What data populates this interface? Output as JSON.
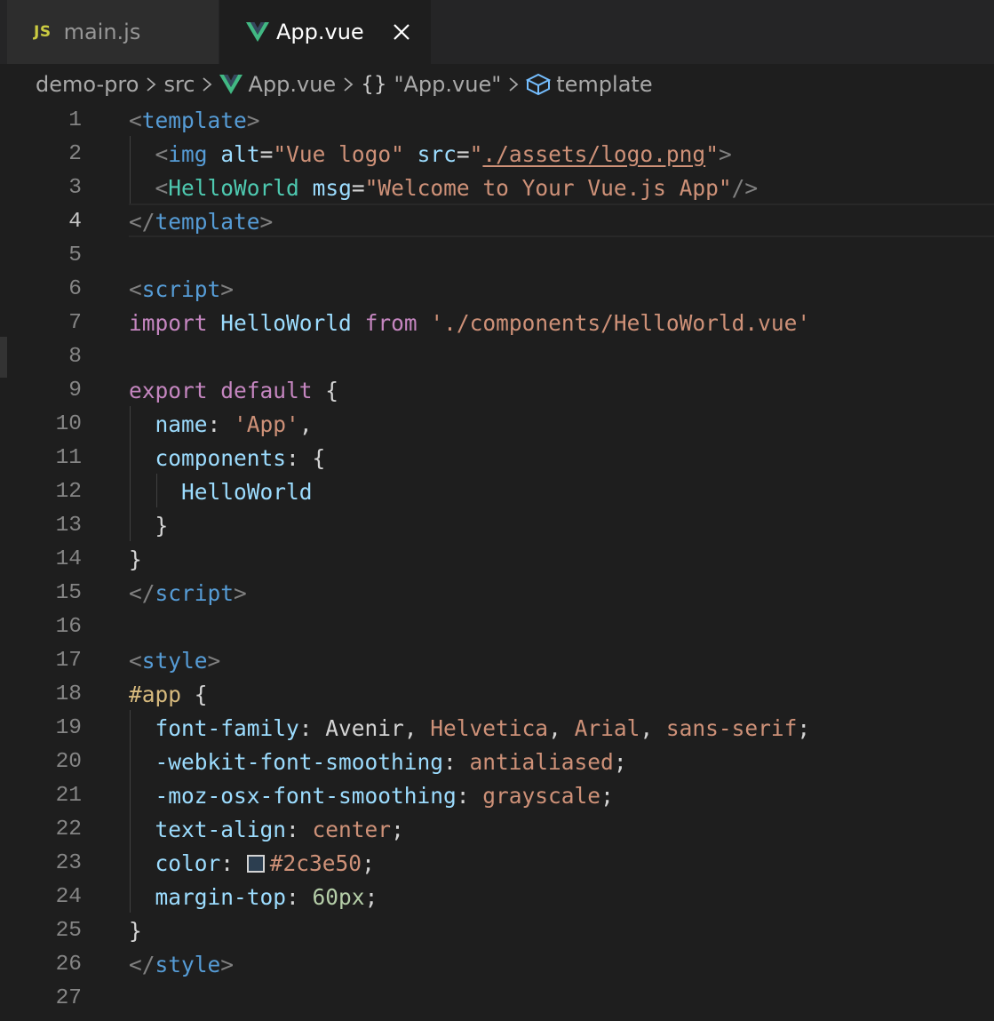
{
  "tabs": [
    {
      "icon": "JS",
      "label": "main.js",
      "active": false
    },
    {
      "icon": "vue-logo",
      "label": "App.vue",
      "active": true
    }
  ],
  "breadcrumb": {
    "items": [
      "demo-pro",
      "src",
      "App.vue",
      "\"App.vue\"",
      "template"
    ]
  },
  "colors": {
    "swatch": "#2c3e50",
    "vue_green": "#41b883"
  },
  "editor": {
    "current_line": 4,
    "lines": [
      [
        [
          "t-brk",
          "<"
        ],
        [
          "t-tag",
          "template"
        ],
        [
          "t-brk",
          ">"
        ]
      ],
      [
        [
          "t-txt",
          "  "
        ],
        [
          "t-brk",
          "<"
        ],
        [
          "t-tag",
          "img"
        ],
        [
          "t-txt",
          " "
        ],
        [
          "t-attr",
          "alt"
        ],
        [
          "t-txt",
          "="
        ],
        [
          "t-str",
          "\"Vue logo\""
        ],
        [
          "t-txt",
          " "
        ],
        [
          "t-attr",
          "src"
        ],
        [
          "t-txt",
          "="
        ],
        [
          "t-str",
          "\""
        ],
        [
          "t-link",
          "./assets/logo.png"
        ],
        [
          "t-str",
          "\""
        ],
        [
          "t-brk",
          ">"
        ]
      ],
      [
        [
          "t-txt",
          "  "
        ],
        [
          "t-brk",
          "<"
        ],
        [
          "t-comp",
          "HelloWorld"
        ],
        [
          "t-txt",
          " "
        ],
        [
          "t-attr",
          "msg"
        ],
        [
          "t-txt",
          "="
        ],
        [
          "t-str",
          "\"Welcome to Your Vue.js App\""
        ],
        [
          "t-brk",
          "/>"
        ]
      ],
      [
        [
          "t-brk",
          "</"
        ],
        [
          "t-tag",
          "template"
        ],
        [
          "t-brk",
          ">"
        ]
      ],
      [],
      [
        [
          "t-brk",
          "<"
        ],
        [
          "t-tag",
          "script"
        ],
        [
          "t-brk",
          ">"
        ]
      ],
      [
        [
          "t-kw",
          "import"
        ],
        [
          "t-txt",
          " "
        ],
        [
          "t-var",
          "HelloWorld"
        ],
        [
          "t-txt",
          " "
        ],
        [
          "t-kw",
          "from"
        ],
        [
          "t-txt",
          " "
        ],
        [
          "t-str",
          "'./components/HelloWorld.vue'"
        ]
      ],
      [],
      [
        [
          "t-kw",
          "export"
        ],
        [
          "t-txt",
          " "
        ],
        [
          "t-kw",
          "default"
        ],
        [
          "t-txt",
          " {"
        ]
      ],
      [
        [
          "t-txt",
          "  "
        ],
        [
          "t-var",
          "name"
        ],
        [
          "t-txt",
          ": "
        ],
        [
          "t-str",
          "'App'"
        ],
        [
          "t-txt",
          ","
        ]
      ],
      [
        [
          "t-txt",
          "  "
        ],
        [
          "t-var",
          "components"
        ],
        [
          "t-txt",
          ": {"
        ]
      ],
      [
        [
          "t-txt",
          "    "
        ],
        [
          "t-var",
          "HelloWorld"
        ]
      ],
      [
        [
          "t-txt",
          "  }"
        ]
      ],
      [
        [
          "t-txt",
          "}"
        ]
      ],
      [
        [
          "t-brk",
          "</"
        ],
        [
          "t-tag",
          "script"
        ],
        [
          "t-brk",
          ">"
        ]
      ],
      [],
      [
        [
          "t-brk",
          "<"
        ],
        [
          "t-tag",
          "style"
        ],
        [
          "t-brk",
          ">"
        ]
      ],
      [
        [
          "t-sel",
          "#app"
        ],
        [
          "t-txt",
          " {"
        ]
      ],
      [
        [
          "t-txt",
          "  "
        ],
        [
          "t-attr",
          "font-family"
        ],
        [
          "t-txt",
          ": Avenir, "
        ],
        [
          "t-str",
          "Helvetica"
        ],
        [
          "t-txt",
          ", "
        ],
        [
          "t-str",
          "Arial"
        ],
        [
          "t-txt",
          ", "
        ],
        [
          "t-str",
          "sans-serif"
        ],
        [
          "t-txt",
          ";"
        ]
      ],
      [
        [
          "t-txt",
          "  "
        ],
        [
          "t-attr",
          "-webkit-font-smoothing"
        ],
        [
          "t-txt",
          ": "
        ],
        [
          "t-str",
          "antialiased"
        ],
        [
          "t-txt",
          ";"
        ]
      ],
      [
        [
          "t-txt",
          "  "
        ],
        [
          "t-attr",
          "-moz-osx-font-smoothing"
        ],
        [
          "t-txt",
          ": "
        ],
        [
          "t-str",
          "grayscale"
        ],
        [
          "t-txt",
          ";"
        ]
      ],
      [
        [
          "t-txt",
          "  "
        ],
        [
          "t-attr",
          "text-align"
        ],
        [
          "t-txt",
          ": "
        ],
        [
          "t-str",
          "center"
        ],
        [
          "t-txt",
          ";"
        ]
      ],
      [
        [
          "t-txt",
          "  "
        ],
        [
          "t-attr",
          "color"
        ],
        [
          "t-txt",
          ": "
        ],
        [
          "swatch",
          ""
        ],
        [
          "t-str",
          "#2c3e50"
        ],
        [
          "t-txt",
          ";"
        ]
      ],
      [
        [
          "t-txt",
          "  "
        ],
        [
          "t-attr",
          "margin-top"
        ],
        [
          "t-txt",
          ": "
        ],
        [
          "t-num",
          "60px"
        ],
        [
          "t-txt",
          ";"
        ]
      ],
      [
        [
          "t-txt",
          "}"
        ]
      ],
      [
        [
          "t-brk",
          "</"
        ],
        [
          "t-tag",
          "style"
        ],
        [
          "t-brk",
          ">"
        ]
      ],
      []
    ]
  }
}
